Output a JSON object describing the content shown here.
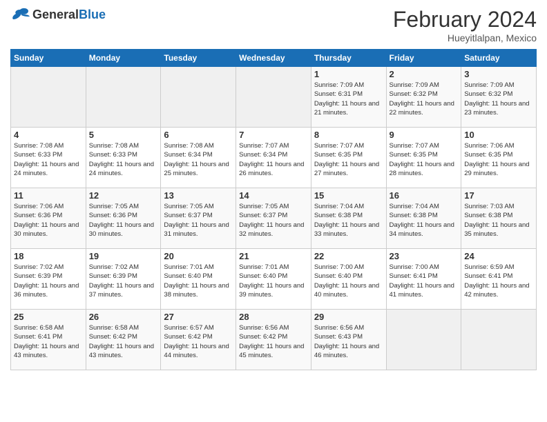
{
  "header": {
    "logo_general": "General",
    "logo_blue": "Blue",
    "title": "February 2024",
    "subtitle": "Hueyitlalpan, Mexico"
  },
  "days_of_week": [
    "Sunday",
    "Monday",
    "Tuesday",
    "Wednesday",
    "Thursday",
    "Friday",
    "Saturday"
  ],
  "weeks": [
    [
      {
        "day": "",
        "info": ""
      },
      {
        "day": "",
        "info": ""
      },
      {
        "day": "",
        "info": ""
      },
      {
        "day": "",
        "info": ""
      },
      {
        "day": "1",
        "info": "Sunrise: 7:09 AM\nSunset: 6:31 PM\nDaylight: 11 hours and 21 minutes."
      },
      {
        "day": "2",
        "info": "Sunrise: 7:09 AM\nSunset: 6:32 PM\nDaylight: 11 hours and 22 minutes."
      },
      {
        "day": "3",
        "info": "Sunrise: 7:09 AM\nSunset: 6:32 PM\nDaylight: 11 hours and 23 minutes."
      }
    ],
    [
      {
        "day": "4",
        "info": "Sunrise: 7:08 AM\nSunset: 6:33 PM\nDaylight: 11 hours and 24 minutes."
      },
      {
        "day": "5",
        "info": "Sunrise: 7:08 AM\nSunset: 6:33 PM\nDaylight: 11 hours and 24 minutes."
      },
      {
        "day": "6",
        "info": "Sunrise: 7:08 AM\nSunset: 6:34 PM\nDaylight: 11 hours and 25 minutes."
      },
      {
        "day": "7",
        "info": "Sunrise: 7:07 AM\nSunset: 6:34 PM\nDaylight: 11 hours and 26 minutes."
      },
      {
        "day": "8",
        "info": "Sunrise: 7:07 AM\nSunset: 6:35 PM\nDaylight: 11 hours and 27 minutes."
      },
      {
        "day": "9",
        "info": "Sunrise: 7:07 AM\nSunset: 6:35 PM\nDaylight: 11 hours and 28 minutes."
      },
      {
        "day": "10",
        "info": "Sunrise: 7:06 AM\nSunset: 6:35 PM\nDaylight: 11 hours and 29 minutes."
      }
    ],
    [
      {
        "day": "11",
        "info": "Sunrise: 7:06 AM\nSunset: 6:36 PM\nDaylight: 11 hours and 30 minutes."
      },
      {
        "day": "12",
        "info": "Sunrise: 7:05 AM\nSunset: 6:36 PM\nDaylight: 11 hours and 30 minutes."
      },
      {
        "day": "13",
        "info": "Sunrise: 7:05 AM\nSunset: 6:37 PM\nDaylight: 11 hours and 31 minutes."
      },
      {
        "day": "14",
        "info": "Sunrise: 7:05 AM\nSunset: 6:37 PM\nDaylight: 11 hours and 32 minutes."
      },
      {
        "day": "15",
        "info": "Sunrise: 7:04 AM\nSunset: 6:38 PM\nDaylight: 11 hours and 33 minutes."
      },
      {
        "day": "16",
        "info": "Sunrise: 7:04 AM\nSunset: 6:38 PM\nDaylight: 11 hours and 34 minutes."
      },
      {
        "day": "17",
        "info": "Sunrise: 7:03 AM\nSunset: 6:38 PM\nDaylight: 11 hours and 35 minutes."
      }
    ],
    [
      {
        "day": "18",
        "info": "Sunrise: 7:02 AM\nSunset: 6:39 PM\nDaylight: 11 hours and 36 minutes."
      },
      {
        "day": "19",
        "info": "Sunrise: 7:02 AM\nSunset: 6:39 PM\nDaylight: 11 hours and 37 minutes."
      },
      {
        "day": "20",
        "info": "Sunrise: 7:01 AM\nSunset: 6:40 PM\nDaylight: 11 hours and 38 minutes."
      },
      {
        "day": "21",
        "info": "Sunrise: 7:01 AM\nSunset: 6:40 PM\nDaylight: 11 hours and 39 minutes."
      },
      {
        "day": "22",
        "info": "Sunrise: 7:00 AM\nSunset: 6:40 PM\nDaylight: 11 hours and 40 minutes."
      },
      {
        "day": "23",
        "info": "Sunrise: 7:00 AM\nSunset: 6:41 PM\nDaylight: 11 hours and 41 minutes."
      },
      {
        "day": "24",
        "info": "Sunrise: 6:59 AM\nSunset: 6:41 PM\nDaylight: 11 hours and 42 minutes."
      }
    ],
    [
      {
        "day": "25",
        "info": "Sunrise: 6:58 AM\nSunset: 6:41 PM\nDaylight: 11 hours and 43 minutes."
      },
      {
        "day": "26",
        "info": "Sunrise: 6:58 AM\nSunset: 6:42 PM\nDaylight: 11 hours and 43 minutes."
      },
      {
        "day": "27",
        "info": "Sunrise: 6:57 AM\nSunset: 6:42 PM\nDaylight: 11 hours and 44 minutes."
      },
      {
        "day": "28",
        "info": "Sunrise: 6:56 AM\nSunset: 6:42 PM\nDaylight: 11 hours and 45 minutes."
      },
      {
        "day": "29",
        "info": "Sunrise: 6:56 AM\nSunset: 6:43 PM\nDaylight: 11 hours and 46 minutes."
      },
      {
        "day": "",
        "info": ""
      },
      {
        "day": "",
        "info": ""
      }
    ]
  ]
}
